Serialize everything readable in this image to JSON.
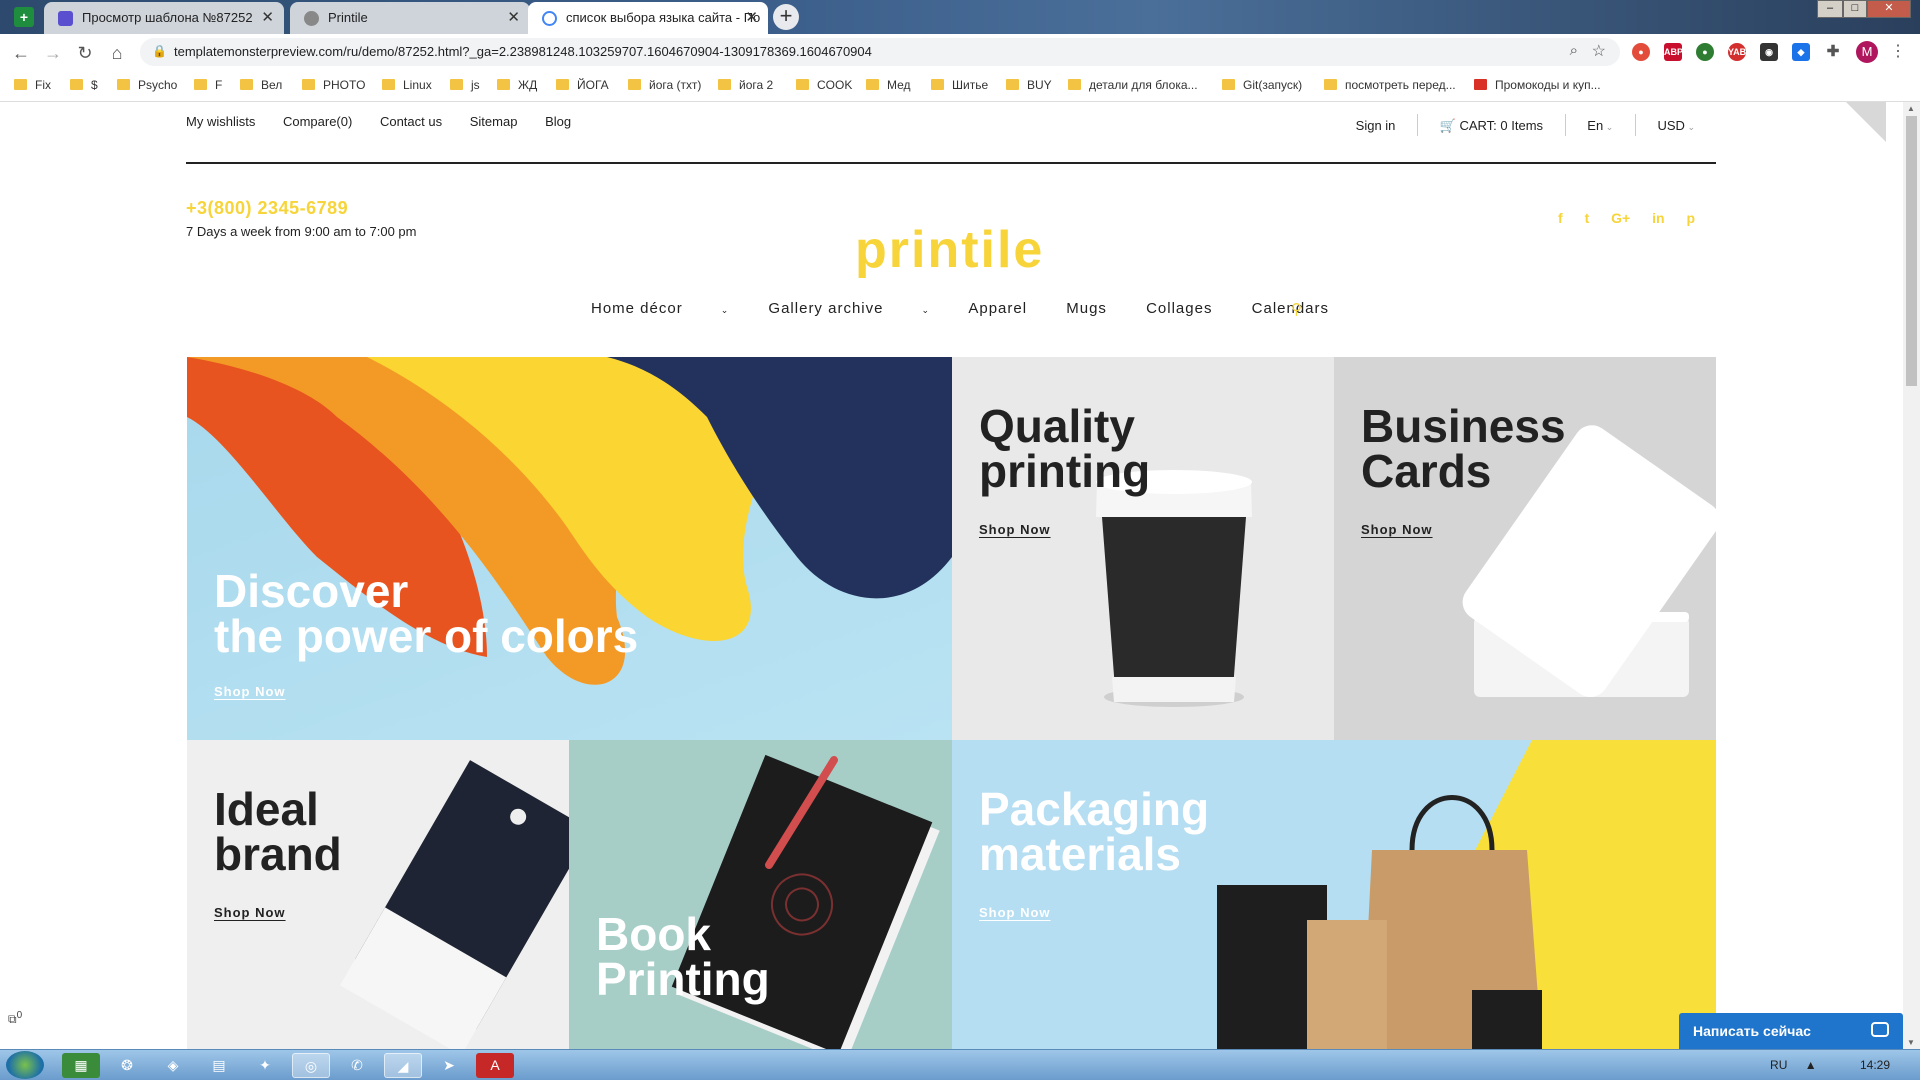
{
  "browser": {
    "tabs": [
      {
        "title": "Просмотр шаблона №87252",
        "active": false
      },
      {
        "title": "Printile",
        "active": true
      },
      {
        "title": "список выбора языка сайта - По",
        "active": false
      }
    ],
    "url": "templatemonsterpreview.com/ru/demo/87252.html?_ga=2.238981248.103259707.1604670904-1309178369.1604670904",
    "extensions": [
      "ABP",
      "YAB"
    ],
    "profile_initial": "M",
    "bookmarks": [
      "Fix",
      "$",
      "Psycho",
      "F",
      "Вел",
      "PHOTO",
      "Linux",
      "js",
      "ЖД",
      "ЙОГА",
      "йога (тхт)",
      "йога 2",
      "COOK",
      "Мед",
      "Шитье",
      "BUY",
      "детали для блока...",
      "Git(запуск)",
      "посмотреть перед...",
      "Промокоды и куп..."
    ]
  },
  "site": {
    "top_links": [
      "My wishlists",
      "Compare(0)",
      "Contact us",
      "Sitemap",
      "Blog"
    ],
    "sign_in": "Sign in",
    "cart_label": "CART:",
    "cart_count": "0 Items",
    "language": "En",
    "currency": "USD",
    "phone": "+3(800) 2345-6789",
    "hours": "7 Days a week from 9:00 am to 7:00 pm",
    "logo": "printile",
    "social": [
      "f",
      "t",
      "G+",
      "in",
      "p"
    ],
    "menu": [
      "Home décor",
      "Gallery archive",
      "Apparel",
      "Mugs",
      "Collages",
      "Calendars"
    ],
    "banners": [
      {
        "title1": "Discover",
        "title2": "the power of colors",
        "cta": "Shop Now"
      },
      {
        "title1": "Quality",
        "title2": "printing",
        "cta": "Shop Now"
      },
      {
        "title1": "Business",
        "title2": "Cards",
        "cta": "Shop Now"
      },
      {
        "title1": "Ideal",
        "title2": "brand",
        "cta": "Shop Now"
      },
      {
        "title1": "Book",
        "title2": "Printing",
        "cta": ""
      },
      {
        "title1": "Packaging",
        "title2": "materials",
        "cta": "Shop Now"
      }
    ]
  },
  "widgets": {
    "chat_label": "Написать сейчас",
    "zoom_count": "0"
  },
  "taskbar": {
    "lang": "RU",
    "time": "14:29"
  },
  "colors": {
    "accent": "#f7d43a",
    "chat": "#1f75cb"
  }
}
